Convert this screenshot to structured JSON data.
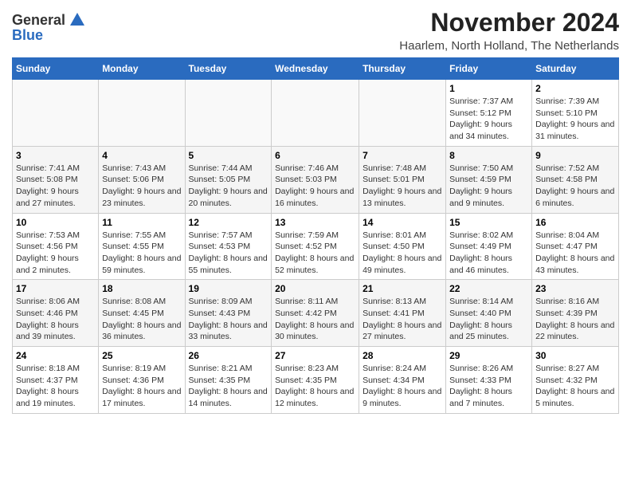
{
  "logo": {
    "general": "General",
    "blue": "Blue"
  },
  "title": "November 2024",
  "subtitle": "Haarlem, North Holland, The Netherlands",
  "headers": [
    "Sunday",
    "Monday",
    "Tuesday",
    "Wednesday",
    "Thursday",
    "Friday",
    "Saturday"
  ],
  "weeks": [
    [
      {
        "day": "",
        "sunrise": "",
        "sunset": "",
        "daylight": ""
      },
      {
        "day": "",
        "sunrise": "",
        "sunset": "",
        "daylight": ""
      },
      {
        "day": "",
        "sunrise": "",
        "sunset": "",
        "daylight": ""
      },
      {
        "day": "",
        "sunrise": "",
        "sunset": "",
        "daylight": ""
      },
      {
        "day": "",
        "sunrise": "",
        "sunset": "",
        "daylight": ""
      },
      {
        "day": "1",
        "sunrise": "Sunrise: 7:37 AM",
        "sunset": "Sunset: 5:12 PM",
        "daylight": "Daylight: 9 hours and 34 minutes."
      },
      {
        "day": "2",
        "sunrise": "Sunrise: 7:39 AM",
        "sunset": "Sunset: 5:10 PM",
        "daylight": "Daylight: 9 hours and 31 minutes."
      }
    ],
    [
      {
        "day": "3",
        "sunrise": "Sunrise: 7:41 AM",
        "sunset": "Sunset: 5:08 PM",
        "daylight": "Daylight: 9 hours and 27 minutes."
      },
      {
        "day": "4",
        "sunrise": "Sunrise: 7:43 AM",
        "sunset": "Sunset: 5:06 PM",
        "daylight": "Daylight: 9 hours and 23 minutes."
      },
      {
        "day": "5",
        "sunrise": "Sunrise: 7:44 AM",
        "sunset": "Sunset: 5:05 PM",
        "daylight": "Daylight: 9 hours and 20 minutes."
      },
      {
        "day": "6",
        "sunrise": "Sunrise: 7:46 AM",
        "sunset": "Sunset: 5:03 PM",
        "daylight": "Daylight: 9 hours and 16 minutes."
      },
      {
        "day": "7",
        "sunrise": "Sunrise: 7:48 AM",
        "sunset": "Sunset: 5:01 PM",
        "daylight": "Daylight: 9 hours and 13 minutes."
      },
      {
        "day": "8",
        "sunrise": "Sunrise: 7:50 AM",
        "sunset": "Sunset: 4:59 PM",
        "daylight": "Daylight: 9 hours and 9 minutes."
      },
      {
        "day": "9",
        "sunrise": "Sunrise: 7:52 AM",
        "sunset": "Sunset: 4:58 PM",
        "daylight": "Daylight: 9 hours and 6 minutes."
      }
    ],
    [
      {
        "day": "10",
        "sunrise": "Sunrise: 7:53 AM",
        "sunset": "Sunset: 4:56 PM",
        "daylight": "Daylight: 9 hours and 2 minutes."
      },
      {
        "day": "11",
        "sunrise": "Sunrise: 7:55 AM",
        "sunset": "Sunset: 4:55 PM",
        "daylight": "Daylight: 8 hours and 59 minutes."
      },
      {
        "day": "12",
        "sunrise": "Sunrise: 7:57 AM",
        "sunset": "Sunset: 4:53 PM",
        "daylight": "Daylight: 8 hours and 55 minutes."
      },
      {
        "day": "13",
        "sunrise": "Sunrise: 7:59 AM",
        "sunset": "Sunset: 4:52 PM",
        "daylight": "Daylight: 8 hours and 52 minutes."
      },
      {
        "day": "14",
        "sunrise": "Sunrise: 8:01 AM",
        "sunset": "Sunset: 4:50 PM",
        "daylight": "Daylight: 8 hours and 49 minutes."
      },
      {
        "day": "15",
        "sunrise": "Sunrise: 8:02 AM",
        "sunset": "Sunset: 4:49 PM",
        "daylight": "Daylight: 8 hours and 46 minutes."
      },
      {
        "day": "16",
        "sunrise": "Sunrise: 8:04 AM",
        "sunset": "Sunset: 4:47 PM",
        "daylight": "Daylight: 8 hours and 43 minutes."
      }
    ],
    [
      {
        "day": "17",
        "sunrise": "Sunrise: 8:06 AM",
        "sunset": "Sunset: 4:46 PM",
        "daylight": "Daylight: 8 hours and 39 minutes."
      },
      {
        "day": "18",
        "sunrise": "Sunrise: 8:08 AM",
        "sunset": "Sunset: 4:45 PM",
        "daylight": "Daylight: 8 hours and 36 minutes."
      },
      {
        "day": "19",
        "sunrise": "Sunrise: 8:09 AM",
        "sunset": "Sunset: 4:43 PM",
        "daylight": "Daylight: 8 hours and 33 minutes."
      },
      {
        "day": "20",
        "sunrise": "Sunrise: 8:11 AM",
        "sunset": "Sunset: 4:42 PM",
        "daylight": "Daylight: 8 hours and 30 minutes."
      },
      {
        "day": "21",
        "sunrise": "Sunrise: 8:13 AM",
        "sunset": "Sunset: 4:41 PM",
        "daylight": "Daylight: 8 hours and 27 minutes."
      },
      {
        "day": "22",
        "sunrise": "Sunrise: 8:14 AM",
        "sunset": "Sunset: 4:40 PM",
        "daylight": "Daylight: 8 hours and 25 minutes."
      },
      {
        "day": "23",
        "sunrise": "Sunrise: 8:16 AM",
        "sunset": "Sunset: 4:39 PM",
        "daylight": "Daylight: 8 hours and 22 minutes."
      }
    ],
    [
      {
        "day": "24",
        "sunrise": "Sunrise: 8:18 AM",
        "sunset": "Sunset: 4:37 PM",
        "daylight": "Daylight: 8 hours and 19 minutes."
      },
      {
        "day": "25",
        "sunrise": "Sunrise: 8:19 AM",
        "sunset": "Sunset: 4:36 PM",
        "daylight": "Daylight: 8 hours and 17 minutes."
      },
      {
        "day": "26",
        "sunrise": "Sunrise: 8:21 AM",
        "sunset": "Sunset: 4:35 PM",
        "daylight": "Daylight: 8 hours and 14 minutes."
      },
      {
        "day": "27",
        "sunrise": "Sunrise: 8:23 AM",
        "sunset": "Sunset: 4:35 PM",
        "daylight": "Daylight: 8 hours and 12 minutes."
      },
      {
        "day": "28",
        "sunrise": "Sunrise: 8:24 AM",
        "sunset": "Sunset: 4:34 PM",
        "daylight": "Daylight: 8 hours and 9 minutes."
      },
      {
        "day": "29",
        "sunrise": "Sunrise: 8:26 AM",
        "sunset": "Sunset: 4:33 PM",
        "daylight": "Daylight: 8 hours and 7 minutes."
      },
      {
        "day": "30",
        "sunrise": "Sunrise: 8:27 AM",
        "sunset": "Sunset: 4:32 PM",
        "daylight": "Daylight: 8 hours and 5 minutes."
      }
    ]
  ]
}
